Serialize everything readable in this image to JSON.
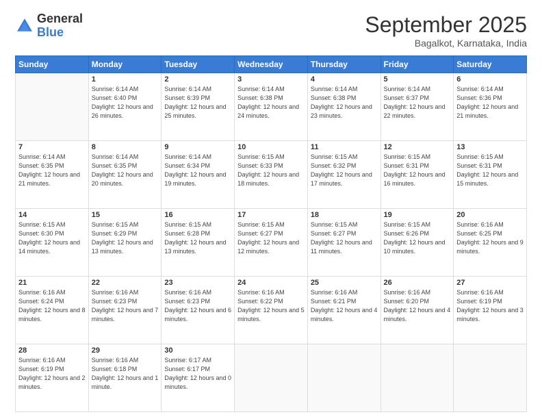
{
  "header": {
    "logo_general": "General",
    "logo_blue": "Blue",
    "month_title": "September 2025",
    "subtitle": "Bagalkot, Karnataka, India"
  },
  "weekdays": [
    "Sunday",
    "Monday",
    "Tuesday",
    "Wednesday",
    "Thursday",
    "Friday",
    "Saturday"
  ],
  "weeks": [
    [
      {
        "day": "",
        "empty": true
      },
      {
        "day": "1",
        "rise": "6:14 AM",
        "set": "6:40 PM",
        "hours": "12 hours and 26 minutes."
      },
      {
        "day": "2",
        "rise": "6:14 AM",
        "set": "6:39 PM",
        "hours": "12 hours and 25 minutes."
      },
      {
        "day": "3",
        "rise": "6:14 AM",
        "set": "6:38 PM",
        "hours": "12 hours and 24 minutes."
      },
      {
        "day": "4",
        "rise": "6:14 AM",
        "set": "6:38 PM",
        "hours": "12 hours and 23 minutes."
      },
      {
        "day": "5",
        "rise": "6:14 AM",
        "set": "6:37 PM",
        "hours": "12 hours and 22 minutes."
      },
      {
        "day": "6",
        "rise": "6:14 AM",
        "set": "6:36 PM",
        "hours": "12 hours and 21 minutes."
      }
    ],
    [
      {
        "day": "7",
        "rise": "6:14 AM",
        "set": "6:35 PM",
        "hours": "12 hours and 21 minutes."
      },
      {
        "day": "8",
        "rise": "6:14 AM",
        "set": "6:35 PM",
        "hours": "12 hours and 20 minutes."
      },
      {
        "day": "9",
        "rise": "6:14 AM",
        "set": "6:34 PM",
        "hours": "12 hours and 19 minutes."
      },
      {
        "day": "10",
        "rise": "6:15 AM",
        "set": "6:33 PM",
        "hours": "12 hours and 18 minutes."
      },
      {
        "day": "11",
        "rise": "6:15 AM",
        "set": "6:32 PM",
        "hours": "12 hours and 17 minutes."
      },
      {
        "day": "12",
        "rise": "6:15 AM",
        "set": "6:31 PM",
        "hours": "12 hours and 16 minutes."
      },
      {
        "day": "13",
        "rise": "6:15 AM",
        "set": "6:31 PM",
        "hours": "12 hours and 15 minutes."
      }
    ],
    [
      {
        "day": "14",
        "rise": "6:15 AM",
        "set": "6:30 PM",
        "hours": "12 hours and 14 minutes."
      },
      {
        "day": "15",
        "rise": "6:15 AM",
        "set": "6:29 PM",
        "hours": "12 hours and 13 minutes."
      },
      {
        "day": "16",
        "rise": "6:15 AM",
        "set": "6:28 PM",
        "hours": "12 hours and 13 minutes."
      },
      {
        "day": "17",
        "rise": "6:15 AM",
        "set": "6:27 PM",
        "hours": "12 hours and 12 minutes."
      },
      {
        "day": "18",
        "rise": "6:15 AM",
        "set": "6:27 PM",
        "hours": "12 hours and 11 minutes."
      },
      {
        "day": "19",
        "rise": "6:15 AM",
        "set": "6:26 PM",
        "hours": "12 hours and 10 minutes."
      },
      {
        "day": "20",
        "rise": "6:16 AM",
        "set": "6:25 PM",
        "hours": "12 hours and 9 minutes."
      }
    ],
    [
      {
        "day": "21",
        "rise": "6:16 AM",
        "set": "6:24 PM",
        "hours": "12 hours and 8 minutes."
      },
      {
        "day": "22",
        "rise": "6:16 AM",
        "set": "6:23 PM",
        "hours": "12 hours and 7 minutes."
      },
      {
        "day": "23",
        "rise": "6:16 AM",
        "set": "6:23 PM",
        "hours": "12 hours and 6 minutes."
      },
      {
        "day": "24",
        "rise": "6:16 AM",
        "set": "6:22 PM",
        "hours": "12 hours and 5 minutes."
      },
      {
        "day": "25",
        "rise": "6:16 AM",
        "set": "6:21 PM",
        "hours": "12 hours and 4 minutes."
      },
      {
        "day": "26",
        "rise": "6:16 AM",
        "set": "6:20 PM",
        "hours": "12 hours and 4 minutes."
      },
      {
        "day": "27",
        "rise": "6:16 AM",
        "set": "6:19 PM",
        "hours": "12 hours and 3 minutes."
      }
    ],
    [
      {
        "day": "28",
        "rise": "6:16 AM",
        "set": "6:19 PM",
        "hours": "12 hours and 2 minutes."
      },
      {
        "day": "29",
        "rise": "6:16 AM",
        "set": "6:18 PM",
        "hours": "12 hours and 1 minute."
      },
      {
        "day": "30",
        "rise": "6:17 AM",
        "set": "6:17 PM",
        "hours": "12 hours and 0 minutes."
      },
      {
        "day": "",
        "empty": true
      },
      {
        "day": "",
        "empty": true
      },
      {
        "day": "",
        "empty": true
      },
      {
        "day": "",
        "empty": true
      }
    ]
  ],
  "labels": {
    "sunrise": "Sunrise:",
    "sunset": "Sunset:",
    "daylight": "Daylight:"
  }
}
